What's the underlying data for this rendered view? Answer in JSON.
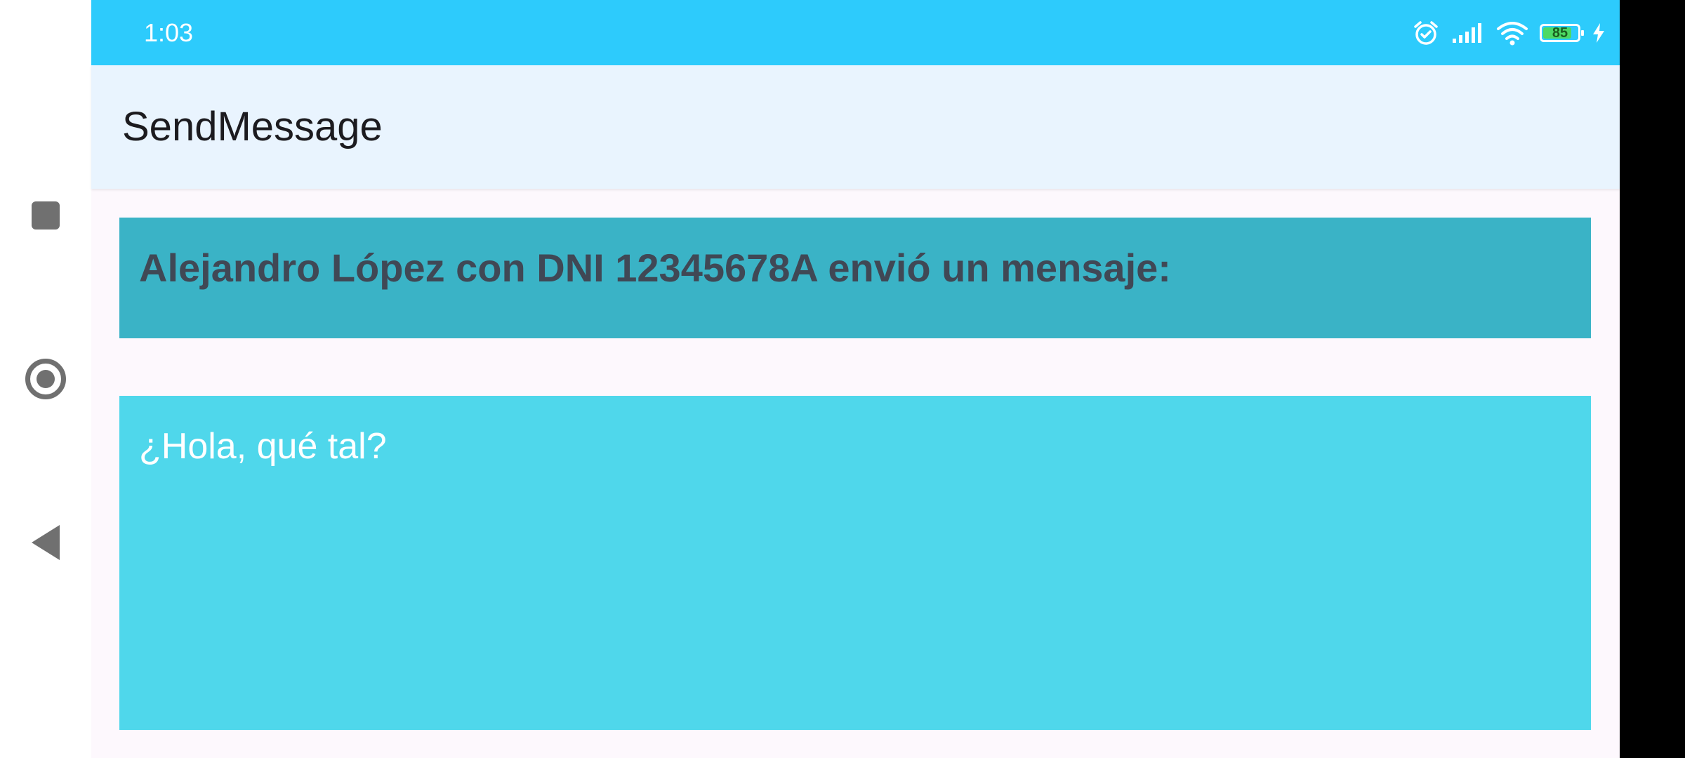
{
  "status_bar": {
    "time": "1:03",
    "battery_level": "85",
    "battery_fraction": 0.85,
    "icons": [
      "alarm-icon",
      "signal-icon",
      "wifi-icon",
      "battery-icon",
      "charging-icon"
    ]
  },
  "app_bar": {
    "title": "SendMessage"
  },
  "content": {
    "header": "Alejandro López con DNI 12345678A envió un mensaje:",
    "message": "¿Hola, qué tal?"
  },
  "nav": {
    "buttons": [
      "recents-icon",
      "home-icon",
      "back-icon"
    ]
  },
  "colors": {
    "status_bar": "#2dcbfc",
    "app_bar": "#e9f4fe",
    "header_box": "#3ab3c6",
    "message_box": "#4fd7eb",
    "background": "#fdf8fd"
  }
}
